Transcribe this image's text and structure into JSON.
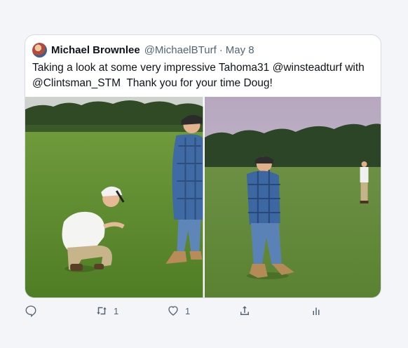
{
  "tweet": {
    "author_name": "Michael Brownlee",
    "handle": "@MichaelBTurf",
    "separator": "·",
    "date": "May 8",
    "text": "Taking a look at some very impressive Tahoma31 @winsteadturf with @Clintsman_STM  Thank you for your time Doug!"
  },
  "media": [
    {
      "icon": "photo-left",
      "subject": "turf inspection"
    },
    {
      "icon": "photo-right",
      "subject": "turf field"
    }
  ],
  "actions": {
    "reply": {
      "icon": "reply-icon",
      "count": ""
    },
    "retweet": {
      "icon": "retweet-icon",
      "count": "1"
    },
    "like": {
      "icon": "heart-icon",
      "count": "1"
    },
    "share": {
      "icon": "share-icon",
      "count": ""
    },
    "analytics": {
      "icon": "analytics-icon",
      "count": ""
    }
  },
  "colors": {
    "background": "#f4f5f9",
    "text": "#0f1419",
    "muted": "#536471",
    "border": "#d7dbe0"
  }
}
